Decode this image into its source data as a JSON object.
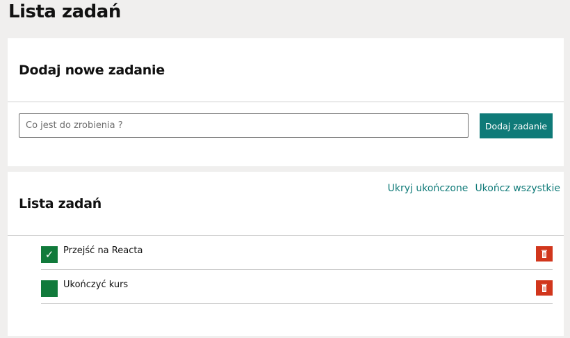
{
  "page": {
    "title": "Lista zadań"
  },
  "add_section": {
    "title": "Dodaj nowe zadanie",
    "input": {
      "placeholder": "Co jest do zrobienia ?",
      "value": ""
    },
    "button_label": "Dodaj zadanie"
  },
  "list_section": {
    "title": "Lista zadań",
    "hide_done_label": "Ukryj ukończone",
    "complete_all_label": "Ukończ wszystkie",
    "tasks": [
      {
        "text": "Przejść na Reacta",
        "done": true
      },
      {
        "text": "Ukończyć kurs",
        "done": false
      }
    ]
  },
  "colors": {
    "accent": "#0f7a78",
    "checkbox": "#117a3b",
    "delete": "#d1361c"
  },
  "icons": {
    "check": "check-icon",
    "delete": "trash-icon"
  }
}
